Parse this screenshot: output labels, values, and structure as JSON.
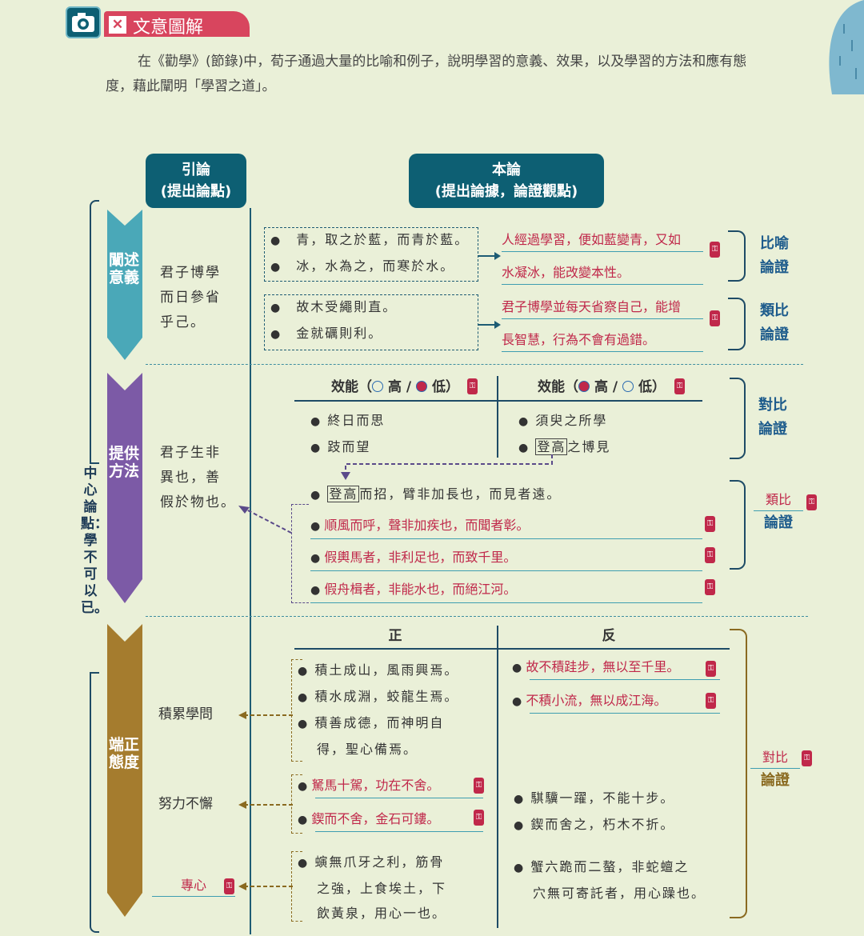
{
  "header": {
    "title": "文意圖解",
    "intro": "在《勸學》(節錄)中，荀子通過大量的比喻和例子，說明學習的意義、效果，以及學習的方法和應有態度，藉此闡明「學習之道」。"
  },
  "columns": {
    "left_title": "引論",
    "left_sub": "(提出論點)",
    "right_title": "本論",
    "right_sub": "(提出論據，論證觀點)"
  },
  "central": "中心論點：學不可以已。",
  "sections": {
    "s1": {
      "label": "闡述意義",
      "thesis": [
        "君子博學",
        "而日參省",
        "乎己。"
      ],
      "g1": [
        "青，取之於藍，而青於藍。",
        "冰，水為之，而寒於水。"
      ],
      "g1_exp": [
        "人經過學習，便如藍變青，又如",
        "水凝冰，能改變本性。"
      ],
      "g1_tag": [
        "比喻",
        "論證"
      ],
      "g2": [
        "故木受繩則直。",
        "金就礪則利。"
      ],
      "g2_exp": [
        "君子博學並每天省察自己，能增",
        "長智慧，行為不會有過錯。"
      ],
      "g2_tag": [
        "類比",
        "論證"
      ]
    },
    "s2": {
      "label": "提供方法",
      "thesis": [
        "君子生非",
        "異也，善",
        "假於物也。"
      ],
      "head_left": {
        "pre": "效能（",
        "a": "高",
        "sep": "/",
        "b": "低）"
      },
      "head_right": {
        "pre": "效能（",
        "a": "高",
        "sep": "/",
        "b": "低）"
      },
      "left_items": [
        "終日而思",
        "跂而望"
      ],
      "right_items": [
        "須臾之所學",
        "之博見"
      ],
      "right_boxed": "登高",
      "compare_tag": [
        "對比",
        "論證"
      ],
      "lead_boxed": "登高",
      "lead_rest": "而招，臂非加長也，而見者遠。",
      "exp": [
        "順風而呼，聲非加疾也，而聞者彰。",
        "假輿馬者，非利足也，而致千里。",
        "假舟楫者，非能水也，而絕江河。"
      ],
      "analogy_tag": [
        "類比",
        "論證"
      ]
    },
    "s3": {
      "label": "端正態度",
      "col_pos": "正",
      "col_neg": "反",
      "t1": "積累學問",
      "t2": "努力不懈",
      "t3": "專心",
      "pos1": [
        "積土成山，風雨興焉。",
        "積水成淵，蛟龍生焉。",
        "積善成德，而神明自",
        "得，聖心備焉。"
      ],
      "neg1": [
        "故不積跬步，無以至千里。",
        "不積小流，無以成江海。"
      ],
      "pos2": [
        "駑馬十駕，功在不舍。",
        "鍥而不舍，金石可鏤。"
      ],
      "neg2": [
        "騏驥一躍，不能十步。",
        "鍥而舍之，朽木不折。"
      ],
      "pos3": [
        "螾無爪牙之利，筋骨",
        "之強，上食埃土，下",
        "飲黃泉，用心一也。"
      ],
      "neg3": [
        "蟹六跪而二螯，非蛇蟺之",
        "穴無可寄託者，用心躁也。"
      ],
      "tag_top": "對比",
      "tag_bottom": "論證"
    }
  }
}
